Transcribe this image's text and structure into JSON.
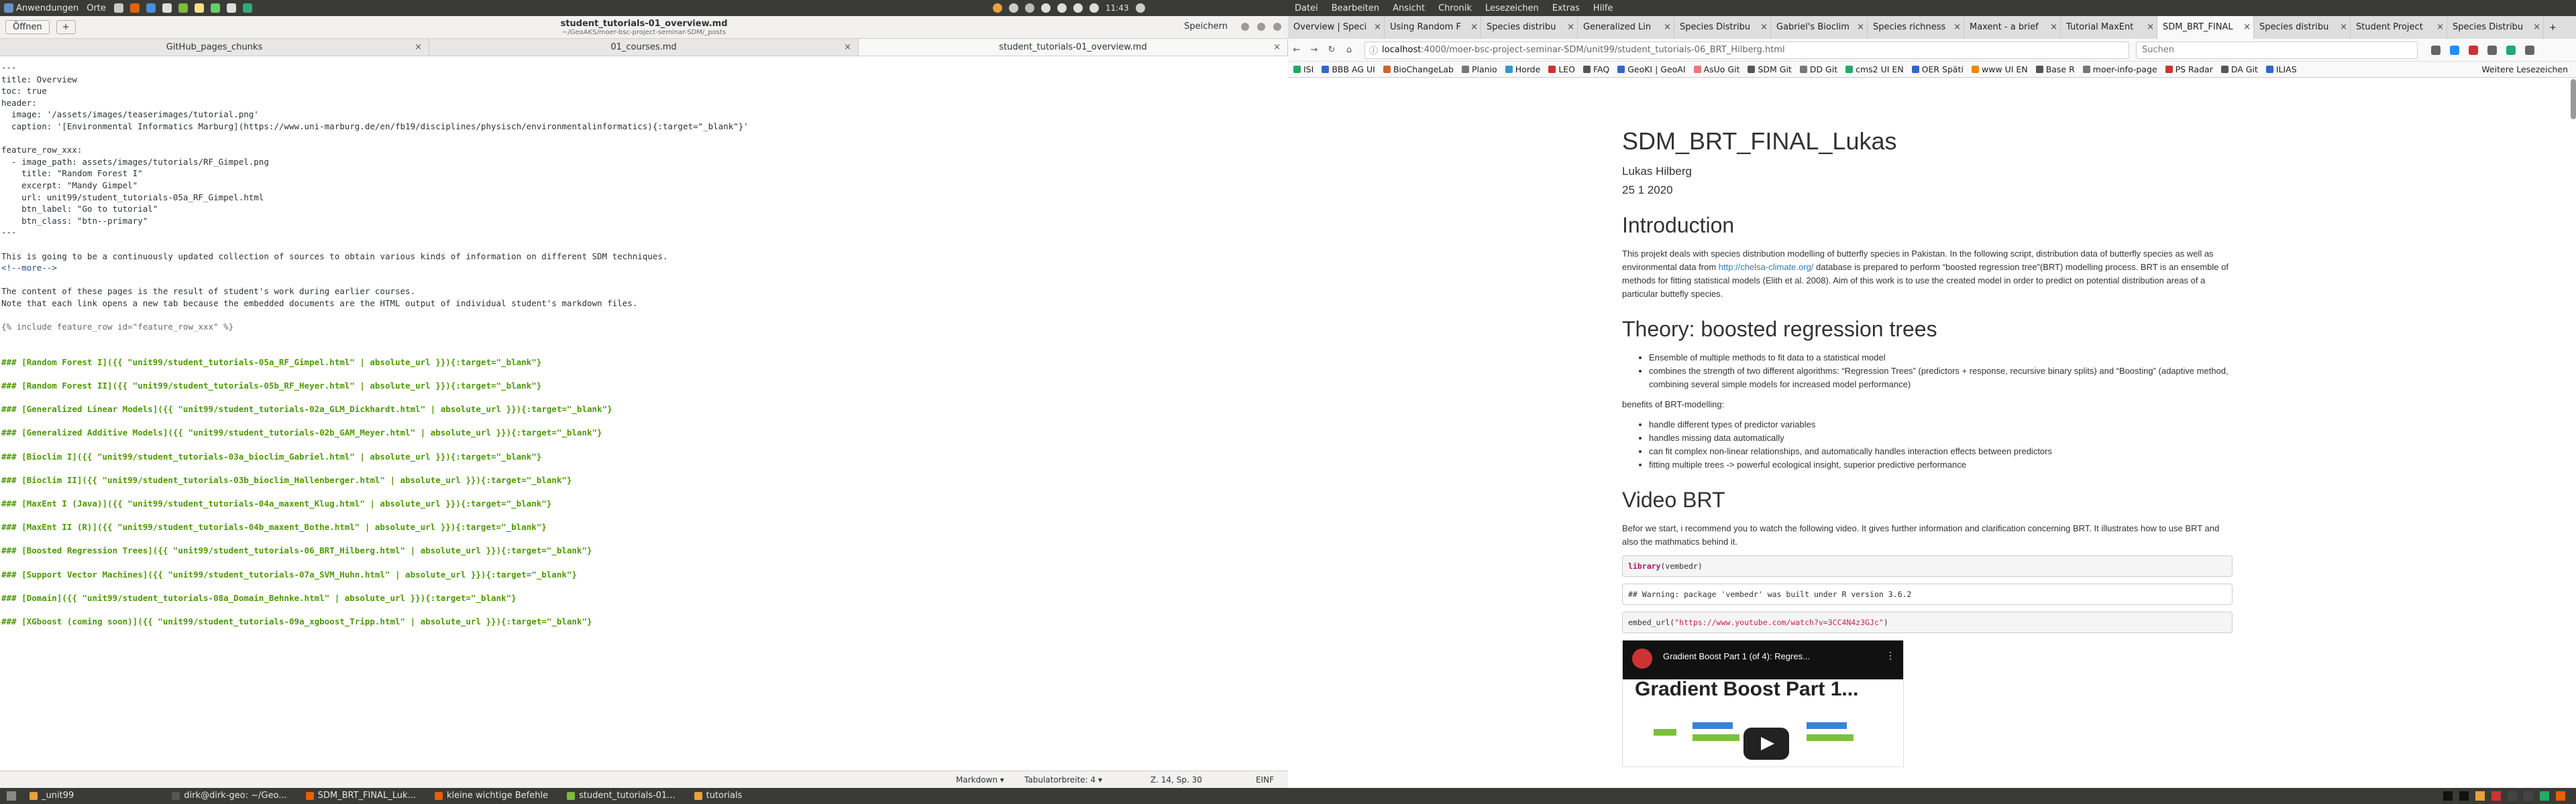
{
  "topbar": {
    "applications": "Anwendungen",
    "places": "Orte",
    "time": "11:43",
    "menus": [
      "Datei",
      "Bearbeiten",
      "Ansicht",
      "Chronik",
      "Lesezeichen",
      "Extras",
      "Hilfe"
    ]
  },
  "editor": {
    "open_label": "Öffnen",
    "title": "student_tutorials-01_overview.md",
    "subtitle": "~/GeoAKS/moer-bsc-project-seminar-SDM/_posts",
    "save_label": "Speichern",
    "tabs": [
      "GitHub_pages_chunks",
      "01_courses.md",
      "student_tutorials-01_overview.md"
    ],
    "lines": [
      "---",
      "title: Overview",
      "toc: true",
      "header:",
      "  image: '/assets/images/teaserimages/tutorial.png'",
      "  caption: '[Environmental Informatics Marburg](https://www.uni-marburg.de/en/fb19/disciplines/physisch/environmentalinformatics){:target=\"_blank\"}'",
      "",
      "feature_row_xxx:",
      "  - image_path: assets/images/tutorials/RF_Gimpel.png",
      "    title: \"Random Forest I\"",
      "    excerpt: \"Mandy Gimpel\"",
      "    url: unit99/student_tutorials-05a_RF_Gimpel.html",
      "    btn_label: \"Go to tutorial\"",
      "    btn_class: \"btn--primary\"",
      "---",
      "",
      "This is going to be a continuously updated collection of sources to obtain various kinds of information on different SDM techniques.",
      "<!--more-->",
      "",
      "The content of these pages is the result of student's work during earlier courses.",
      "Note that each link opens a new tab because the embedded documents are the HTML output of individual student's markdown files.",
      "",
      "{% include feature_row id=\"feature_row_xxx\" %}",
      "",
      "",
      "### [Random Forest I]({{ \"unit99/student_tutorials-05a_RF_Gimpel.html\" | absolute_url }}){:target=\"_blank\"}",
      "",
      "### [Random Forest II]({{ \"unit99/student_tutorials-05b_RF_Heyer.html\" | absolute_url }}){:target=\"_blank\"}",
      "",
      "### [Generalized Linear Models]({{ \"unit99/student_tutorials-02a_GLM_Dickhardt.html\" | absolute_url }}){:target=\"_blank\"}",
      "",
      "### [Generalized Additive Models]({{ \"unit99/student_tutorials-02b_GAM_Meyer.html\" | absolute_url }}){:target=\"_blank\"}",
      "",
      "### [Bioclim I]({{ \"unit99/student_tutorials-03a_bioclim_Gabriel.html\" | absolute_url }}){:target=\"_blank\"}",
      "",
      "### [Bioclim II]({{ \"unit99/student_tutorials-03b_bioclim_Hallenberger.html\" | absolute_url }}){:target=\"_blank\"}",
      "",
      "### [MaxEnt I (Java)]({{ \"unit99/student_tutorials-04a_maxent_Klug.html\" | absolute_url }}){:target=\"_blank\"}",
      "",
      "### [MaxEnt II (R)]({{ \"unit99/student_tutorials-04b_maxent_Bothe.html\" | absolute_url }}){:target=\"_blank\"}",
      "",
      "### [Boosted Regression Trees]({{ \"unit99/student_tutorials-06_BRT_Hilberg.html\" | absolute_url }}){:target=\"_blank\"}",
      "",
      "### [Support Vector Machines]({{ \"unit99/student_tutorials-07a_SVM_Huhn.html\" | absolute_url }}){:target=\"_blank\"}",
      "",
      "### [Domain]({{ \"unit99/student_tutorials-08a_Domain_Behnke.html\" | absolute_url }}){:target=\"_blank\"}",
      "",
      "### [XGboost (coming soon)]({{ \"unit99/student_tutorials-09a_xgboost_Tripp.html\" | absolute_url }}){:target=\"_blank\"}"
    ],
    "status": {
      "mode": "Markdown ▾",
      "tabwidth": "Tabulatorbreite: 4 ▾",
      "position": "Z. 14, Sp. 30",
      "insert": "EINF"
    }
  },
  "browser": {
    "tabs": [
      "Overview | Speci",
      "Using Random F",
      "Species distribu",
      "Generalized Lin",
      "Species Distribu",
      "Gabriel's Bioclim",
      "Species richness",
      "Maxent - a brief",
      "Tutorial MaxEnt",
      "SDM_BRT_FINAL",
      "Species distribu",
      "Student Project",
      "Species Distribu"
    ],
    "active_tab": 9,
    "url_host": "localhost",
    "url_path": ":4000/moer-bsc-project-seminar-SDM/unit99/student_tutorials-06_BRT_Hilberg.html",
    "search_placeholder": "Suchen",
    "bookmarks": [
      "ISI",
      "BBB AG UI",
      "BioChangeLab",
      "Planio",
      "Horde",
      "LEO",
      "FAQ",
      "GeoKI | GeoAI",
      "AsUo Git",
      "SDM Git",
      "DD Git",
      "cms2 UI EN",
      "OER Späti",
      "www UI EN",
      "Base R",
      "moer-info-page",
      "PS Radar",
      "DA Git",
      "ILIAS"
    ],
    "other_bookmarks": "Weitere Lesezeichen"
  },
  "page": {
    "title": "SDM_BRT_FINAL_Lukas",
    "author": "Lukas Hilberg",
    "date": "25 1 2020",
    "intro_heading": "Introduction",
    "intro_pre": "This projekt deals with species distribution modelling of butterfly species in Pakistan. In the following script, distribution data of butterfly species as well as environmental data from ",
    "intro_link": "http://chelsa-climate.org/",
    "intro_post": " database is prepared to perform “boosted regression tree”(BRT) modelling process. BRT is an ensemble of methods for fitting statistical models (Elith et al. 2008). Aim of this work is to use the created model in order to predict on potential distribution areas of a particular buttefly species.",
    "theory_heading": "Theory: boosted regression trees",
    "theory_items": [
      "Ensemble of multiple methods to fit data to a statistical model",
      "combines the strength of two different algorithms: “Regression Trees” (predictors + response, recursive binary splits) and “Boosting” (adaptive method, combining several simple models for increased model performance)"
    ],
    "benefits_label": "benefits of BRT-modelling:",
    "benefits_items": [
      "handle different types of predictor variables",
      "handles missing data automatically",
      "can fit complex non-linear relationships, and automatically handles interaction effects between predictors",
      "fitting multiple trees -> powerful ecological insight, superior predictive performance"
    ],
    "video_heading": "Video BRT",
    "video_text": "Befor we start, i recommend you to watch the following video. It gives further information and clarification concerning BRT. It illustrates how to use BRT and also the mathmatics behind it.",
    "code1_kw": "library",
    "code1_arg": "(vembedr)",
    "code2": "## Warning: package 'vembedr' was built under R version 3.6.2",
    "code3_pre": "embed_url(",
    "code3_str": "\"https://www.youtube.com/watch?v=3CC4N4z3GJc\"",
    "code3_post": ")",
    "video_small_title": "Gradient Boost Part 1 (of 4): Regres...",
    "video_big_title": "Gradient Boost Part 1..."
  },
  "taskbar": {
    "items": [
      "_unit99",
      "dirk@dirk-geo: ~/Geo...",
      "SDM_BRT_FINAL_Luk...",
      "kleine wichtige Befehle",
      "student_tutorials-01...",
      "tutorials"
    ]
  }
}
